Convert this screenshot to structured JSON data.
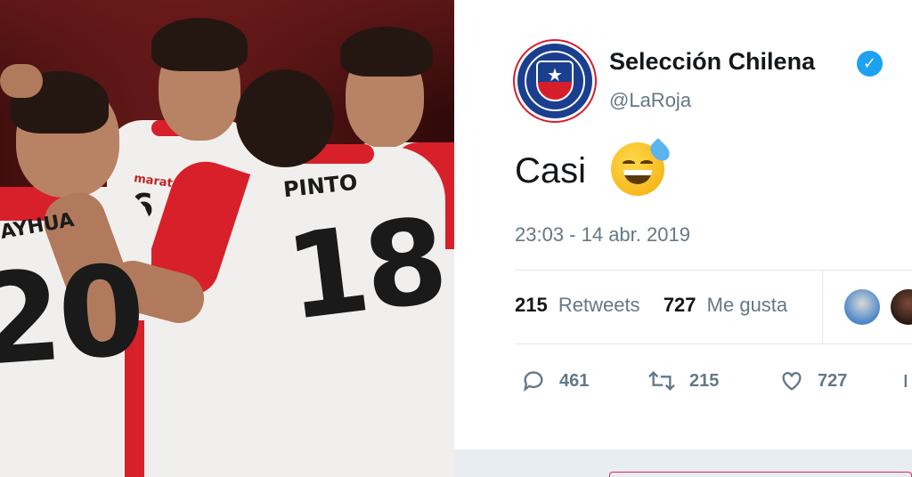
{
  "photo": {
    "jersey_left_name": "AYHUA",
    "jersey_left_number": "20",
    "jersey_center_name": "PINTO",
    "jersey_center_number": "18",
    "jersey_back_number": "6",
    "sponsor": "marathon"
  },
  "tweet": {
    "author_name": "Selección Chilena",
    "handle": "@LaRoja",
    "text": "Casi",
    "timestamp": "23:03 - 14 abr. 2019",
    "retweets_count": "215",
    "retweets_label": "Retweets",
    "likes_count": "727",
    "likes_label": "Me gusta",
    "actions": {
      "replies": "461",
      "retweets": "215",
      "likes": "727"
    }
  },
  "colors": {
    "twitter_blue": "#1da1f2",
    "text_primary": "#14171a",
    "text_secondary": "#657786",
    "divider": "#e1e8ed",
    "peru_red": "#d8202a",
    "chile_blue": "#1b3f8f"
  },
  "icons": {
    "verified": "verified-badge-icon",
    "reply": "reply-icon",
    "retweet": "retweet-icon",
    "like": "heart-icon",
    "emoji": "grinning-sweat-emoji"
  }
}
